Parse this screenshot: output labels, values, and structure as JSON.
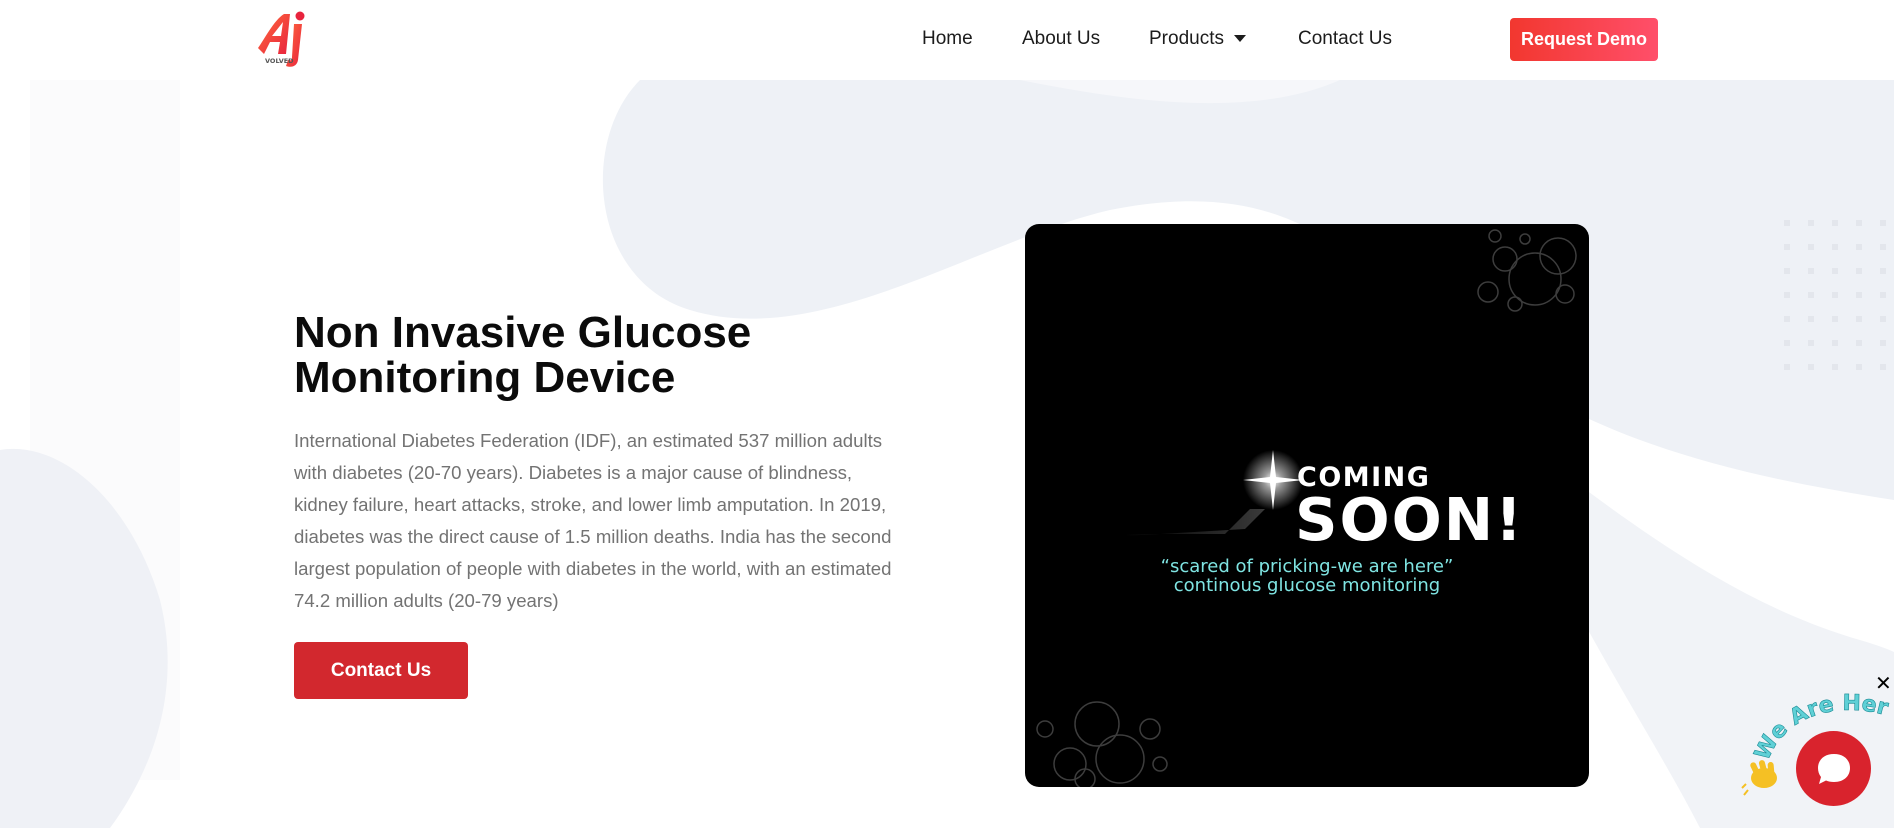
{
  "brand": {
    "logo_text": "VOLVED"
  },
  "nav": {
    "items": [
      {
        "label": "Home"
      },
      {
        "label": "About Us"
      },
      {
        "label": "Products"
      },
      {
        "label": "Contact Us"
      }
    ],
    "cta_label": "Request Demo"
  },
  "hero": {
    "title": "Non Invasive Glucose Monitoring Device",
    "body": "International Diabetes Federation (IDF), an estimated 537 million adults with diabetes (20-70 years). Diabetes is a major cause of blindness, kidney failure, heart attacks, stroke, and lower limb amputation. In 2019, diabetes was the direct cause of 1.5 million deaths. India has the second largest population of people with diabetes in the world, with an estimated 74.2 million adults (20-79 years)",
    "cta_label": "Contact Us"
  },
  "promo": {
    "coming": "COMING",
    "soon": "SOON!",
    "tagline_1": "“scared of pricking-we are here”",
    "tagline_2": "continous glucose monitoring"
  },
  "chat": {
    "badge_text": "We Are Here!",
    "close_glyph": "✕"
  },
  "colors": {
    "accent": "#d2282e",
    "demo_gradient_start": "#f2372f",
    "demo_gradient_end": "#ff4f6a",
    "tagline": "#7fe4e2",
    "body_text": "#737373"
  }
}
